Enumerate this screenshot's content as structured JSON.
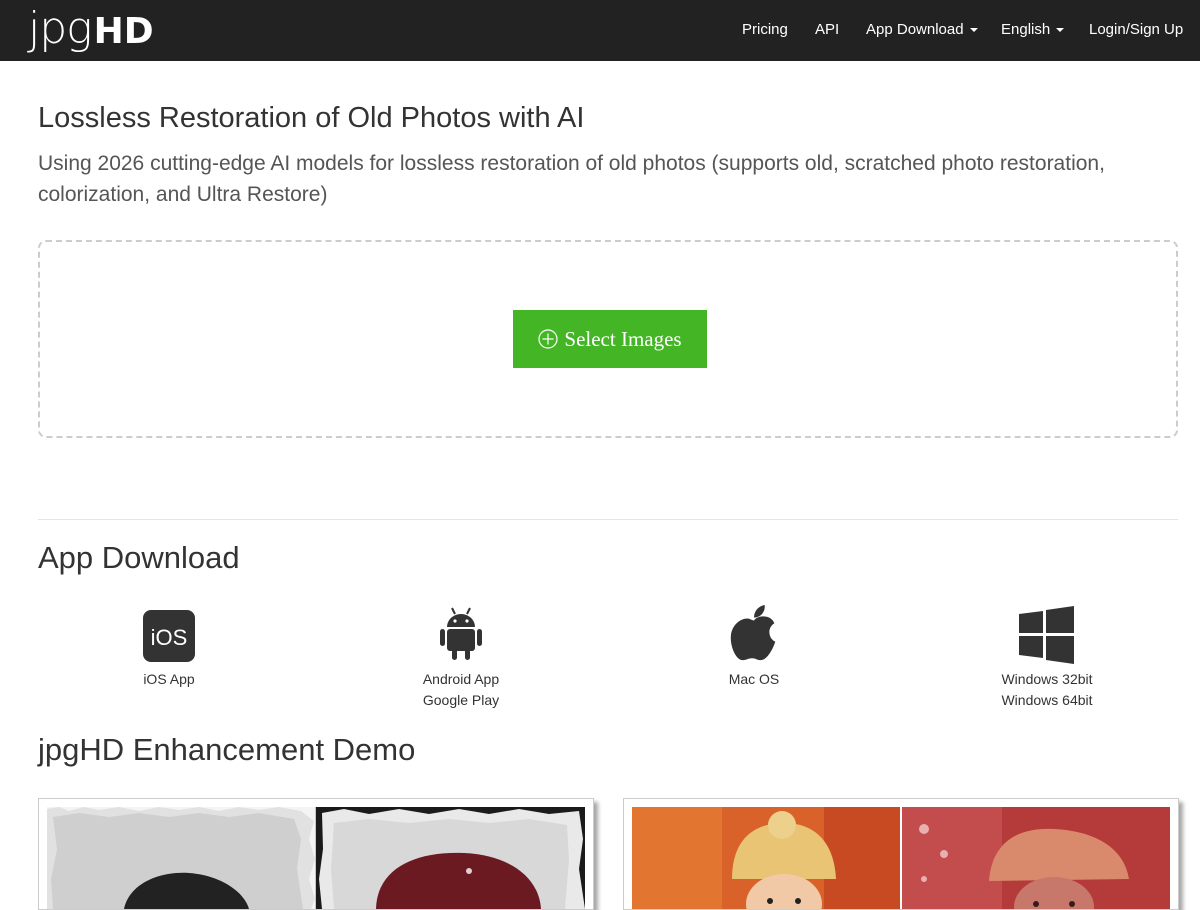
{
  "brand": {
    "logo_thin": "jpg",
    "logo_bold": "HD"
  },
  "nav": {
    "pricing": "Pricing",
    "api": "API",
    "app_download": "App Download",
    "language": "English",
    "login": "Login/Sign Up"
  },
  "hero": {
    "title": "Lossless Restoration of Old Photos with AI",
    "subtitle": "Using 2026 cutting-edge AI models for lossless restoration of old photos (supports old, scratched photo restoration, colorization, and Ultra Restore)",
    "select_button": "Select Images"
  },
  "apps": {
    "heading": "App Download",
    "items": [
      {
        "icon": "ios-icon",
        "icon_text": "iOS",
        "line1": "iOS App",
        "line2": ""
      },
      {
        "icon": "android-icon",
        "line1": "Android App",
        "line2": "Google Play"
      },
      {
        "icon": "apple-icon",
        "line1": "Mac OS",
        "line2": ""
      },
      {
        "icon": "windows-icon",
        "line1": "Windows 32bit",
        "line2": "Windows 64bit"
      }
    ]
  },
  "demo": {
    "heading": "jpgHD Enhancement Demo"
  },
  "colors": {
    "navbar": "#222222",
    "accent_green": "#44b625"
  }
}
